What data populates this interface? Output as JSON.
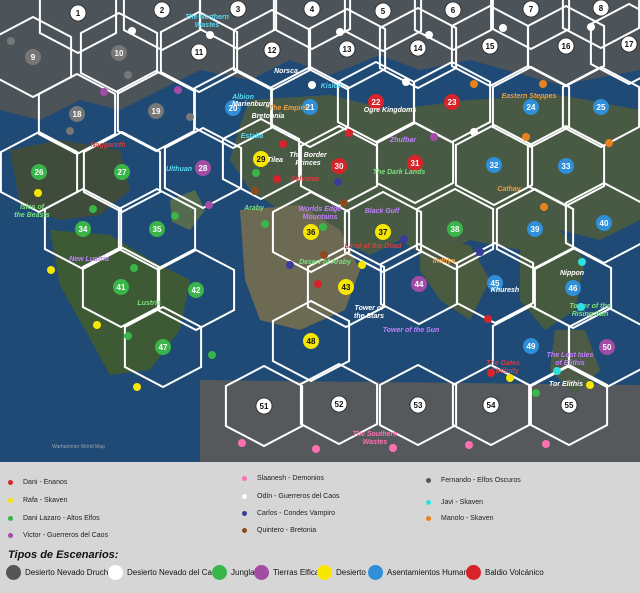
{
  "map": {
    "caption": "Warhammer World Map",
    "regions": [
      {
        "text": "The Northern Wastes",
        "color": "#5ad7f0"
      },
      {
        "text": "Norsca",
        "color": "#ffffff"
      },
      {
        "text": "Kislev",
        "color": "#5ad7f0"
      },
      {
        "text": "Albion",
        "color": "#5ad7f0"
      },
      {
        "text": "Marienburg",
        "color": "#ffffff"
      },
      {
        "text": "The Empire",
        "color": "#f0a040"
      },
      {
        "text": "Bretonnia",
        "color": "#ffffff"
      },
      {
        "text": "Ogre Kingdoms",
        "color": "#ffffff"
      },
      {
        "text": "Eastern Steppes",
        "color": "#f0a040"
      },
      {
        "text": "Naggaroth",
        "color": "#d04040"
      },
      {
        "text": "Estalia",
        "color": "#5ad7f0"
      },
      {
        "text": "Tilea",
        "color": "#ffffff"
      },
      {
        "text": "The Border Princes",
        "color": "#ffffff"
      },
      {
        "text": "Sylvania",
        "color": "#d04040"
      },
      {
        "text": "Zhufbar",
        "color": "#c080ff"
      },
      {
        "text": "The Dark Lands",
        "color": "#7ee07e"
      },
      {
        "text": "Cathay",
        "color": "#f0a040"
      },
      {
        "text": "Ulthuan",
        "color": "#5ad7f0"
      },
      {
        "text": "Isles of the Beasts",
        "color": "#7ee07e"
      },
      {
        "text": "Araby",
        "color": "#7ee07e"
      },
      {
        "text": "Worlds Edge Mountains",
        "color": "#c080ff"
      },
      {
        "text": "Black Gulf",
        "color": "#c080ff"
      },
      {
        "text": "Desert of Araby",
        "color": "#7ee07e"
      },
      {
        "text": "Indhya",
        "color": "#f0a040"
      },
      {
        "text": "New Lustria",
        "color": "#c080ff"
      },
      {
        "text": "Land of the Dead",
        "color": "#d04040"
      },
      {
        "text": "Nippon",
        "color": "#ffffff"
      },
      {
        "text": "Khuresh",
        "color": "#ffffff"
      },
      {
        "text": "Tower of the Rising Sun",
        "color": "#7ee07e"
      },
      {
        "text": "Lustria",
        "color": "#7ee07e"
      },
      {
        "text": "Tower of the Stars",
        "color": "#ffffff"
      },
      {
        "text": "Tower of the Sun",
        "color": "#c080ff"
      },
      {
        "text": "The Gates of Infinity",
        "color": "#d04040"
      },
      {
        "text": "The Lost Isles of Elithis",
        "color": "#c080ff"
      },
      {
        "text": "Tor Elithis",
        "color": "#ffffff"
      },
      {
        "text": "The Southern Wastes",
        "color": "#ff70b0"
      }
    ],
    "hexes": [
      {
        "n": "1",
        "fill": ""
      },
      {
        "n": "2",
        "fill": ""
      },
      {
        "n": "3",
        "fill": ""
      },
      {
        "n": "4",
        "fill": ""
      },
      {
        "n": "5",
        "fill": ""
      },
      {
        "n": "6",
        "fill": ""
      },
      {
        "n": "7",
        "fill": ""
      },
      {
        "n": "8",
        "fill": ""
      },
      {
        "n": "9",
        "fill": "#777777"
      },
      {
        "n": "10",
        "fill": "#777777"
      },
      {
        "n": "11",
        "fill": ""
      },
      {
        "n": "12",
        "fill": ""
      },
      {
        "n": "13",
        "fill": ""
      },
      {
        "n": "14",
        "fill": ""
      },
      {
        "n": "15",
        "fill": ""
      },
      {
        "n": "16",
        "fill": ""
      },
      {
        "n": "17",
        "fill": ""
      },
      {
        "n": "18",
        "fill": "#777777"
      },
      {
        "n": "19",
        "fill": "#777777"
      },
      {
        "n": "20",
        "fill": "#2f8fd8"
      },
      {
        "n": "21",
        "fill": "#2f8fd8"
      },
      {
        "n": "22",
        "fill": "#d8232a"
      },
      {
        "n": "23",
        "fill": "#d8232a"
      },
      {
        "n": "24",
        "fill": "#2f8fd8"
      },
      {
        "n": "25",
        "fill": "#2f8fd8"
      },
      {
        "n": "26",
        "fill": "#3ab54a"
      },
      {
        "n": "27",
        "fill": "#3ab54a"
      },
      {
        "n": "28",
        "fill": "#a24ca6"
      },
      {
        "n": "29",
        "fill": "#f7e700"
      },
      {
        "n": "30",
        "fill": "#d8232a"
      },
      {
        "n": "31",
        "fill": "#d8232a"
      },
      {
        "n": "32",
        "fill": "#2f8fd8"
      },
      {
        "n": "33",
        "fill": "#2f8fd8"
      },
      {
        "n": "34",
        "fill": "#3ab54a"
      },
      {
        "n": "35",
        "fill": "#3ab54a"
      },
      {
        "n": "36",
        "fill": "#f7e700"
      },
      {
        "n": "37",
        "fill": "#f7e700"
      },
      {
        "n": "38",
        "fill": "#3ab54a"
      },
      {
        "n": "39",
        "fill": "#2f8fd8"
      },
      {
        "n": "40",
        "fill": "#2f8fd8"
      },
      {
        "n": "41",
        "fill": "#3ab54a"
      },
      {
        "n": "42",
        "fill": "#3ab54a"
      },
      {
        "n": "43",
        "fill": "#f7e700"
      },
      {
        "n": "44",
        "fill": "#a24ca6"
      },
      {
        "n": "45",
        "fill": "#2f8fd8"
      },
      {
        "n": "46",
        "fill": "#2f8fd8"
      },
      {
        "n": "47",
        "fill": "#3ab54a"
      },
      {
        "n": "48",
        "fill": "#f7e700"
      },
      {
        "n": "49",
        "fill": "#2f8fd8"
      },
      {
        "n": "50",
        "fill": "#a24ca6"
      },
      {
        "n": "51",
        "fill": ""
      },
      {
        "n": "52",
        "fill": ""
      },
      {
        "n": "53",
        "fill": ""
      },
      {
        "n": "54",
        "fill": ""
      },
      {
        "n": "55",
        "fill": ""
      }
    ],
    "markers": [
      {
        "color": "#777777"
      },
      {
        "color": "#ffffff"
      },
      {
        "color": "#ffffff"
      },
      {
        "color": "#ffffff"
      },
      {
        "color": "#ffffff"
      },
      {
        "color": "#ffffff"
      },
      {
        "color": "#ffffff"
      },
      {
        "color": "#777777"
      },
      {
        "color": "#a24ca6"
      },
      {
        "color": "#a24ca6"
      },
      {
        "color": "#777777"
      },
      {
        "color": "#ffffff"
      },
      {
        "color": "#ffffff"
      },
      {
        "color": "#e9821e"
      },
      {
        "color": "#e9821e"
      },
      {
        "color": "#a24ca6"
      },
      {
        "color": "#ffffff"
      },
      {
        "color": "#777777"
      },
      {
        "color": "#d8232a"
      },
      {
        "color": "#d8232a"
      },
      {
        "color": "#e9821e"
      },
      {
        "color": "#e9821e"
      },
      {
        "color": "#3ab54a"
      },
      {
        "color": "#f7e700"
      },
      {
        "color": "#3ab54a"
      },
      {
        "color": "#8b4a1e"
      },
      {
        "color": "#d8232a"
      },
      {
        "color": "#3b3b9a"
      },
      {
        "color": "#a24ca6"
      },
      {
        "color": "#e9821e"
      },
      {
        "color": "#3ab54a"
      },
      {
        "color": "#f7e700"
      },
      {
        "color": "#3ab54a"
      },
      {
        "color": "#3b3b9a"
      },
      {
        "color": "#8b4a1e"
      },
      {
        "color": "#f7e700"
      },
      {
        "color": "#3ab54a"
      },
      {
        "color": "#3ab54a"
      },
      {
        "color": "#3b3b9a"
      },
      {
        "color": "#8b4a1e"
      },
      {
        "color": "#3b3b9a"
      },
      {
        "color": "#d8232a"
      },
      {
        "color": "#f7e700"
      },
      {
        "color": "#3ab54a"
      },
      {
        "color": "#f7e700"
      },
      {
        "color": "#3ab54a"
      },
      {
        "color": "#2fe0e0"
      },
      {
        "color": "#d8232a"
      },
      {
        "color": "#2fe0e0"
      },
      {
        "color": "#f7e700"
      },
      {
        "color": "#3ab54a"
      },
      {
        "color": "#f7e700"
      },
      {
        "color": "#d8232a"
      },
      {
        "color": "#2fe0e0"
      },
      {
        "color": "#ff70b0"
      },
      {
        "color": "#ff70b0"
      },
      {
        "color": "#ff70b0"
      },
      {
        "color": "#ff70b0"
      },
      {
        "color": "#ff70b0"
      }
    ]
  },
  "players_legend": [
    {
      "label": "Dani - Enanos",
      "color": "#d8232a"
    },
    {
      "label": "Rafa - Skaven",
      "color": "#f7e700"
    },
    {
      "label": "Dani Lazaro - Altos Elfos",
      "color": "#3ab54a"
    },
    {
      "label": "Victor - Guerreros del Caos",
      "color": "#a24ca6"
    },
    {
      "label": "Slaanesh - Demonios",
      "color": "#ff70b0"
    },
    {
      "label": "Odín - Guerreros del Caos",
      "color": "#ffffff"
    },
    {
      "label": "Carlos - Condes Vampiro",
      "color": "#3b3b9a"
    },
    {
      "label": "Quintero - Bretonia",
      "color": "#8b4a1e"
    },
    {
      "label": "Fernando - Elfos Oscuros",
      "color": "#555555"
    },
    {
      "label": "Javi - Skaven",
      "color": "#2fe0e0"
    },
    {
      "label": "Manolo - Skaven",
      "color": "#e9821e"
    }
  ],
  "scenario_types": {
    "title": "Tipos de Escenarios:",
    "items": [
      {
        "label": "Desierto Nevado Druchi",
        "color": "#555555"
      },
      {
        "label": "Desierto Nevado del Caos",
        "color": "#ffffff"
      },
      {
        "label": "Jungla",
        "color": "#3ab54a"
      },
      {
        "label": "Tierras Elficas",
        "color": "#a24ca6"
      },
      {
        "label": "Desierto",
        "color": "#f7e700"
      },
      {
        "label": "Asentamientos Humanos",
        "color": "#2f8fd8"
      },
      {
        "label": "Baldio Volcánico",
        "color": "#d8232a"
      }
    ]
  }
}
